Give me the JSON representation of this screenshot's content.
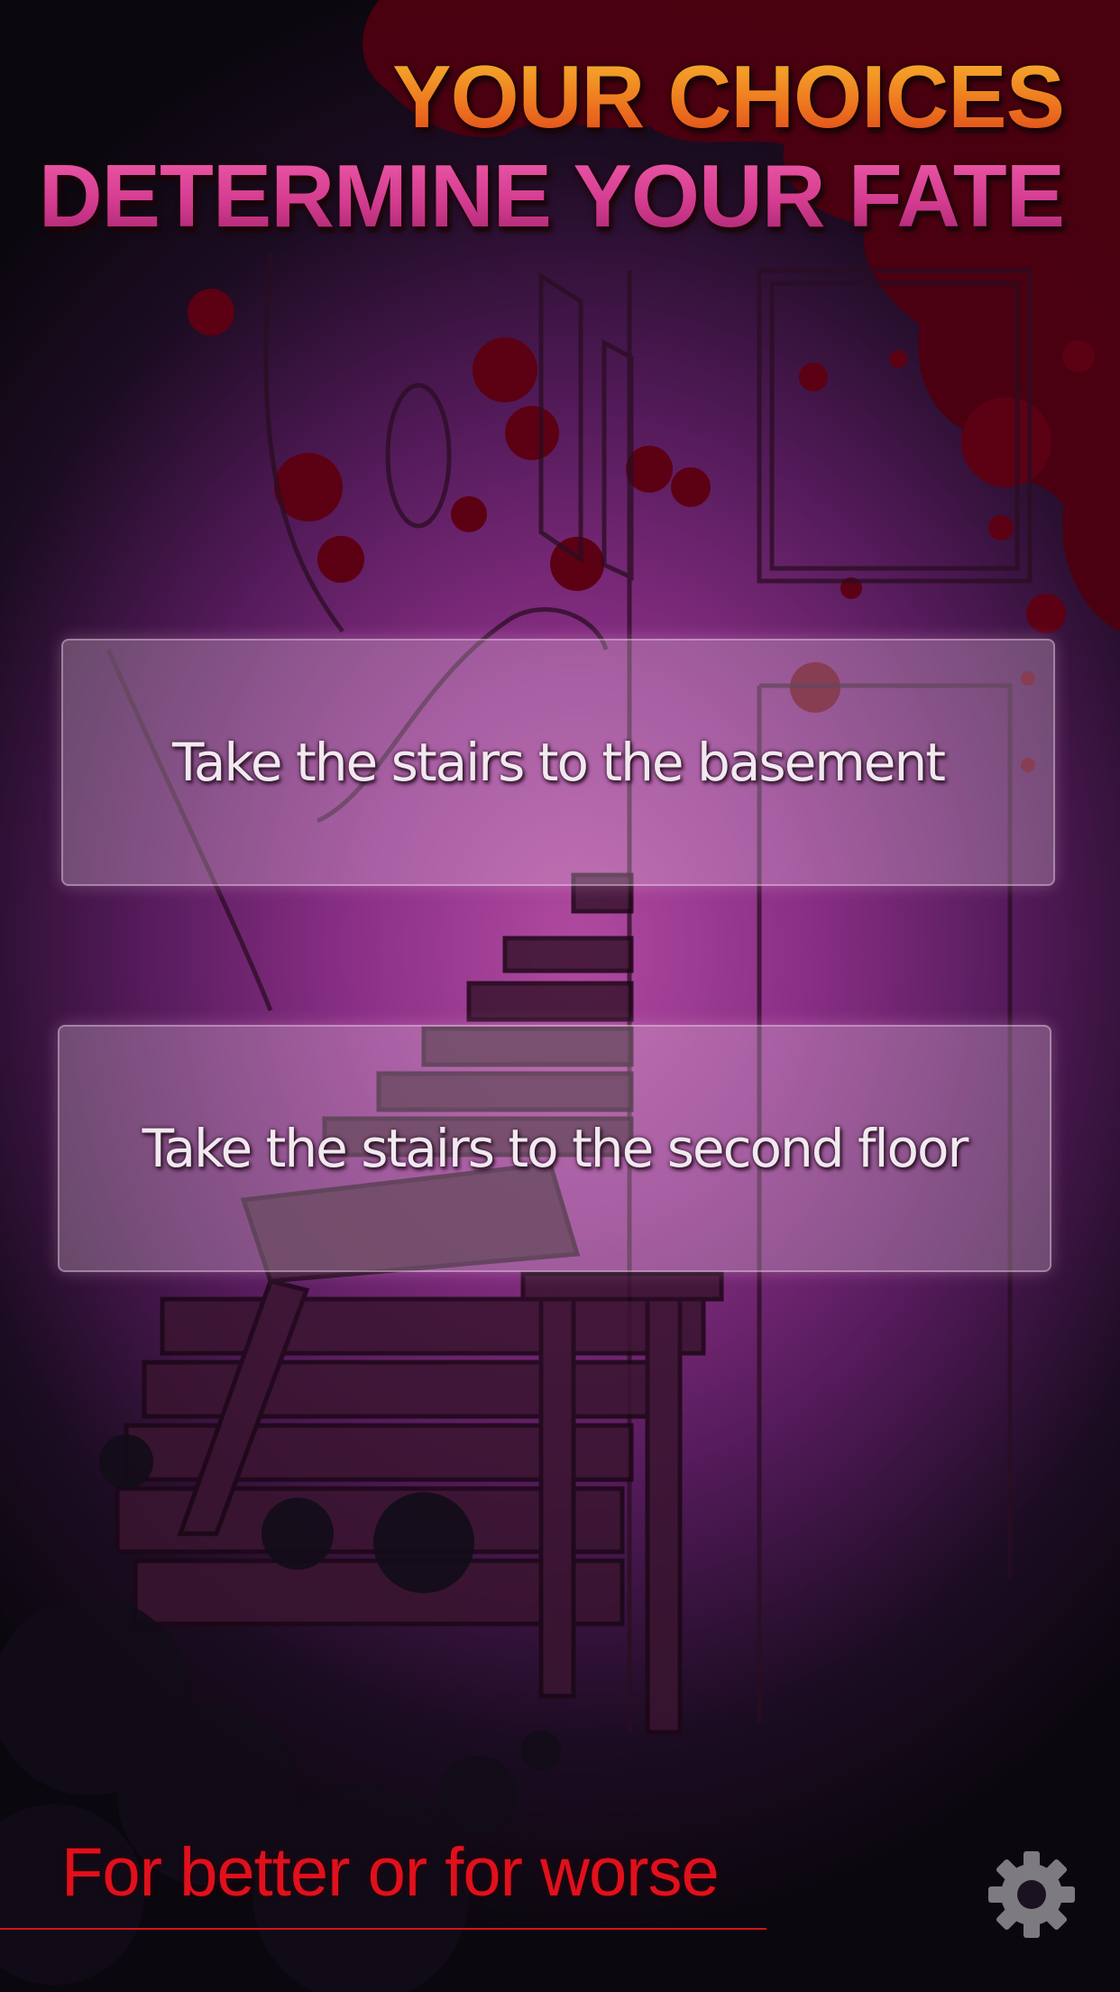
{
  "title": {
    "line1": "YOUR CHOICES",
    "line2": "DETERMINE YOUR FATE"
  },
  "choices": [
    {
      "label": "Take the stairs to the basement"
    },
    {
      "label": "Take the stairs to the second floor"
    }
  ],
  "tagline": "For better or for worse",
  "settings": {
    "icon": "gear-icon"
  },
  "colors": {
    "title_line1": "#ee7a1f",
    "title_line2": "#d13a8e",
    "tagline": "#e0101c",
    "blood": "#5a0010",
    "background_glow": "#b04aa0"
  }
}
